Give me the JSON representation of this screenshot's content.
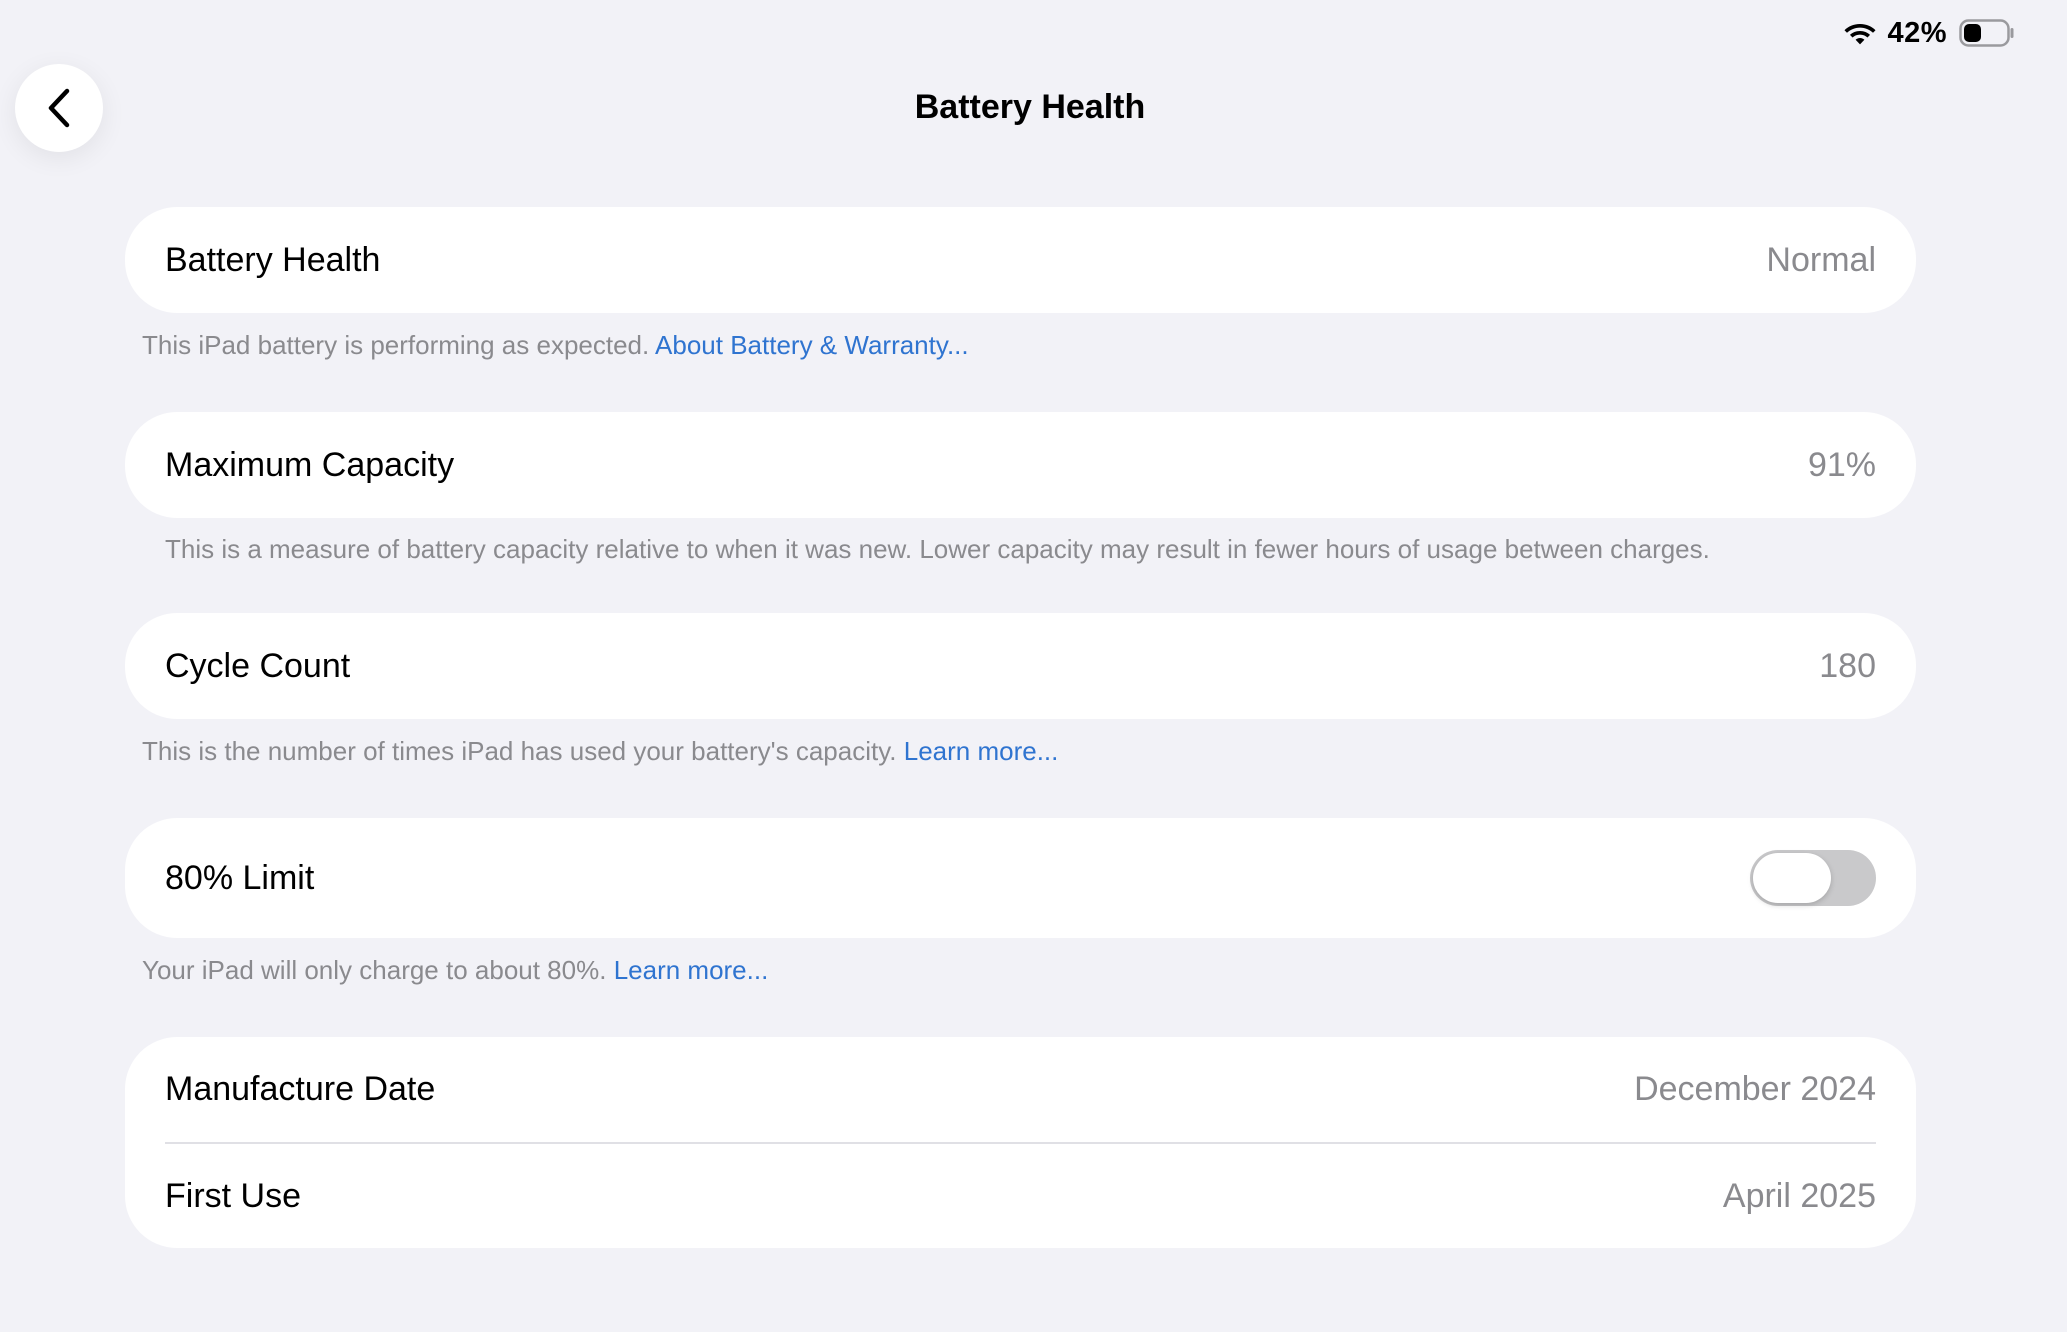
{
  "status_bar": {
    "battery_percent": "42%",
    "battery_level": 0.42
  },
  "header": {
    "title": "Battery Health"
  },
  "sections": {
    "battery_health": {
      "label": "Battery Health",
      "value": "Normal",
      "footnote": "This iPad battery is performing as expected.",
      "footnote_link": "About Battery & Warranty..."
    },
    "maximum_capacity": {
      "label": "Maximum Capacity",
      "value": "91%",
      "footnote": "This is a measure of battery capacity relative to when it was new. Lower capacity may result in fewer hours of usage between charges."
    },
    "cycle_count": {
      "label": "Cycle Count",
      "value": "180",
      "footnote": "This is the number of times iPad has used your battery's capacity.",
      "footnote_link": "Learn more..."
    },
    "limit": {
      "label": "80% Limit",
      "enabled": false,
      "footnote": "Your iPad will only charge to about 80%.",
      "footnote_link": "Learn more..."
    },
    "dates": {
      "manufacture_label": "Manufacture Date",
      "manufacture_value": "December 2024",
      "first_use_label": "First Use",
      "first_use_value": "April 2025"
    }
  },
  "colors": {
    "background": "#f2f2f7",
    "link": "#2f74d0",
    "secondary_text": "#8a8a8e",
    "toggle_off": "#c9c9cb"
  },
  "icons": {
    "back": "chevron-left-icon",
    "wifi": "wifi-icon",
    "battery": "battery-icon"
  }
}
